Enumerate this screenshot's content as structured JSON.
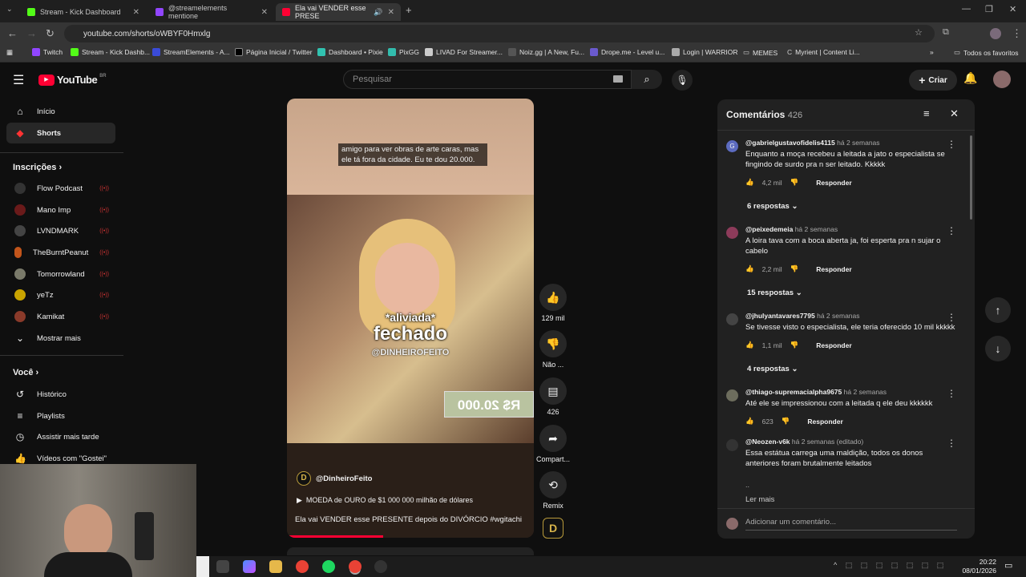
{
  "browser": {
    "tabs": [
      {
        "label": "Stream - Kick Dashboard",
        "color": "#53fc18"
      },
      {
        "label": "@streamelements mentione",
        "color": "#9146ff"
      },
      {
        "label": "Ela vai VENDER esse PRESE",
        "color": "#ff0033"
      }
    ],
    "url": "youtube.com/shorts/oWBYF0Hmxlg",
    "bookmarks": [
      "Twitch",
      "Stream - Kick Dashb...",
      "StreamElements - A...",
      "Página Inicial / Twitter",
      "Dashboard • Pixie",
      "PixGG",
      "LIVAD For Streamer...",
      "Noiz.gg | A New, Fu...",
      "Drope.me - Level u...",
      "Login | WARRIOR",
      "MEMES",
      "Myrient | Content Li..."
    ],
    "all_bookmarks": "Todos os favoritos"
  },
  "youtube": {
    "logo": "YouTube",
    "region": "BR",
    "search_placeholder": "Pesquisar",
    "create_label": "Criar"
  },
  "sidebar": {
    "main": [
      {
        "label": "Início",
        "icon": "home-icon"
      },
      {
        "label": "Shorts",
        "icon": "shorts-icon"
      }
    ],
    "subs_title": "Inscrições",
    "subs": [
      {
        "label": "Flow Podcast",
        "color": "#333"
      },
      {
        "label": "Mano Imp",
        "color": "#6a1a1a"
      },
      {
        "label": "LVNDMARK",
        "color": "#444"
      },
      {
        "label": "TheBurntPeanut",
        "color": "#c2551b"
      },
      {
        "label": "Tomorrowland",
        "color": "#7a7a6a"
      },
      {
        "label": "yeTz",
        "color": "#c9a400"
      },
      {
        "label": "Kamikat",
        "color": "#8a3a2a"
      }
    ],
    "show_more": "Mostrar mais",
    "you_title": "Você",
    "you": [
      {
        "label": "Histórico",
        "icon": "history-icon"
      },
      {
        "label": "Playlists",
        "icon": "playlist-icon"
      },
      {
        "label": "Assistir mais tarde",
        "icon": "clock-icon"
      },
      {
        "label": "Vídeos com \"Gostei\"",
        "icon": "thumb-up-icon"
      }
    ]
  },
  "video": {
    "caption_top": "amigo para ver obras de arte caras, mas ele tá fora da cidade. Eu te dou 20.000.",
    "overlay_1": "*aliviada*",
    "overlay_2": "fechado",
    "watermark": "@DINHEIROFEITO",
    "sign": "R$ 20.000",
    "channel": "@DinheiroFeito",
    "music": "MOEDA de OURO de $1 000 000 milhão de dólares",
    "title": "Ela vai VENDER esse PRESENTE depois do DIVÓRCIO #wgitachi"
  },
  "actions": {
    "likes": "129 mil",
    "dislike": "Não ...",
    "comments": "426",
    "share": "Compart...",
    "remix": "Remix"
  },
  "comments": {
    "title": "Comentários",
    "count": "426",
    "items": [
      {
        "user": "@gabrielgustavofidelis4115",
        "time": "há 2 semanas",
        "text": "Enquanto a moça recebeu a leitada a jato o especialista se fingindo de surdo pra n ser leitado. Kkkkk",
        "likes": "4,2 mil",
        "replies": "6 respostas",
        "color": "#5c6bc0",
        "initial": "G"
      },
      {
        "user": "@peixedemeia",
        "time": "há 2 semanas",
        "text": "A loira tava com a boca aberta ja, foi esperta pra n sujar o cabelo",
        "likes": "2,2 mil",
        "replies": "15 respostas",
        "color": "#8d3b5a",
        "initial": ""
      },
      {
        "user": "@jhulyantavares7795",
        "time": "há 2 semanas",
        "text": "Se tivesse visto o especialista, ele teria oferecido 10 mil kkkkk",
        "likes": "1,1 mil",
        "replies": "4 respostas",
        "color": "#444",
        "initial": ""
      },
      {
        "user": "@thiago-supremacialpha9675",
        "time": "há 2 semanas",
        "text": "Até ele se impressionou com a leitada q ele deu kkkkkk",
        "likes": "623",
        "replies": "",
        "color": "#6d6d5d",
        "initial": ""
      },
      {
        "user": "@Neozen-v6k",
        "time": "há 2 semanas (editado)",
        "text": "Essa estátua carrega uma maldição, todos os donos anteriores foram brutalmente leitados",
        "likes": "",
        "replies": "",
        "color": "#333",
        "initial": ""
      }
    ],
    "reply_label": "Responder",
    "ellipsis": "..",
    "read_more": "Ler mais",
    "add_placeholder": "Adicionar um comentário..."
  },
  "taskbar": {
    "time": "20:22",
    "date": "08/01/2026"
  }
}
